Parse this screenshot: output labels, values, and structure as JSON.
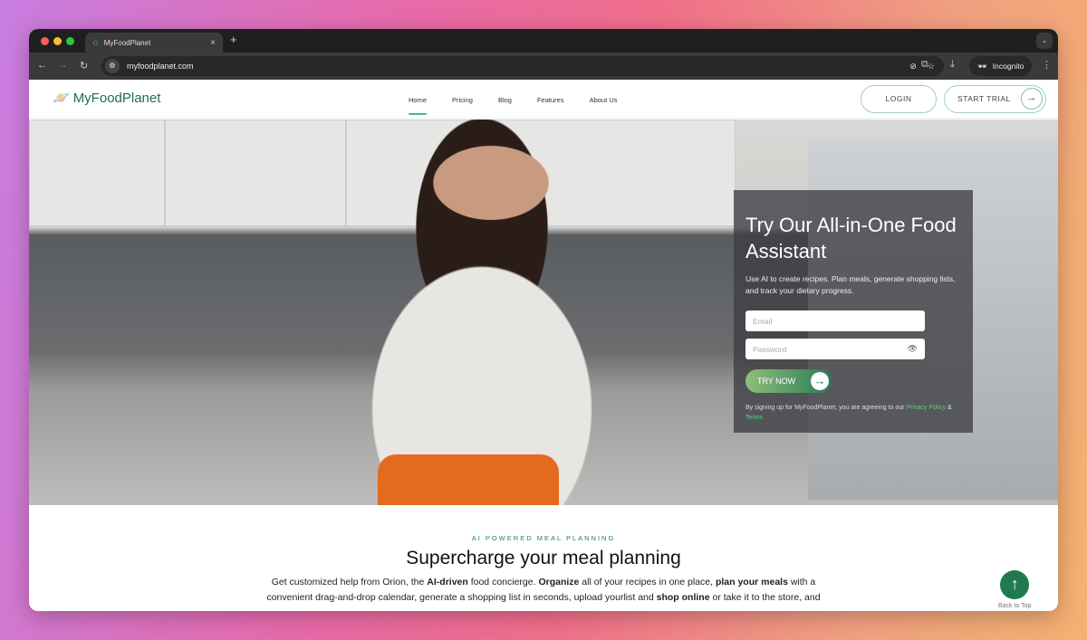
{
  "browser": {
    "tab_title": "MyFoodPlanet",
    "url": "myfoodplanet.com",
    "incognito_label": "Incognito"
  },
  "site": {
    "logo": "MyFoodPlanet",
    "nav": [
      "Home",
      "Pricing",
      "Blog",
      "Features",
      "About Us"
    ],
    "login": "LOGIN",
    "start_trial": "START TRIAL"
  },
  "hero": {
    "title": "Try Our All-in-One Food Assistant",
    "subtitle": "Use AI to create recipes. Plan meals, generate shopping lists, and track your dietary progress.",
    "email_placeholder": "Email",
    "password_placeholder": "Password",
    "cta": "TRY NOW",
    "terms_prefix": "By signing up for MyFoodPlanet, you are agreeing to our ",
    "privacy": "Privacy Policy",
    "amp": " & ",
    "terms": "Terms"
  },
  "section": {
    "eyebrow": "AI POWERED MEAL PLANNING",
    "title": "Supercharge your meal planning",
    "paragraph": [
      {
        "t": "Get customized help from Orion, the ",
        "b": false
      },
      {
        "t": "AI-driven",
        "b": true
      },
      {
        "t": " food concierge. ",
        "b": false
      },
      {
        "t": "Organize",
        "b": true
      },
      {
        "t": " all of your recipes in one place, ",
        "b": false
      },
      {
        "t": "plan your meals",
        "b": true
      },
      {
        "t": " with a convenient drag-and-drop calendar, generate a shopping list in seconds, upload yourlist and ",
        "b": false
      },
      {
        "t": "shop online",
        "b": true
      },
      {
        "t": " or take it to the store, and",
        "b": false
      }
    ]
  },
  "back_to_top": "Back to Top",
  "colors": {
    "brand": "#1f6e4e",
    "accent": "#4ab58a"
  }
}
